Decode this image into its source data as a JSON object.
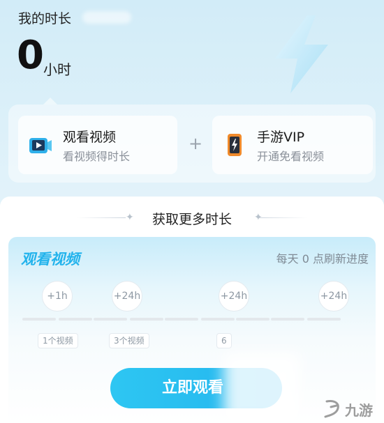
{
  "header": {
    "title": "我的时长",
    "hours_value": "0",
    "hours_unit": "小时"
  },
  "cards": [
    {
      "title": "观看视频",
      "subtitle": "看视频得时长",
      "icon": "video-play-icon"
    },
    {
      "title": "手游VIP",
      "subtitle": "开通免看视频",
      "icon": "phone-bolt-icon"
    }
  ],
  "plus_sign": "+",
  "section": {
    "heading": "获取更多时长",
    "watch_label": "观看视频",
    "reset_note": "每天 0 点刷新进度",
    "milestones": [
      {
        "reward": "+1h",
        "requirement": "1个视频"
      },
      {
        "reward": "+24h",
        "requirement": "3个视频"
      },
      {
        "reward": "+24h",
        "requirement": "6"
      },
      {
        "reward": "+24h",
        "requirement": ""
      }
    ],
    "cta_label": "立即观看"
  },
  "watermark": "九游",
  "colors": {
    "accent": "#23b5ee",
    "background": "#d7edf8",
    "video_icon_bg": "#2fb0ea",
    "phone_icon": "#f08a2b"
  }
}
